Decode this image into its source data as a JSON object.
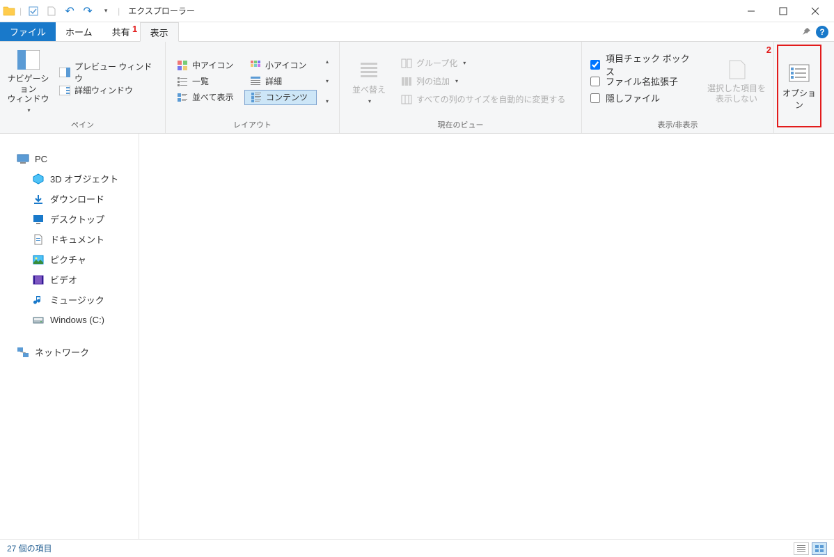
{
  "window": {
    "title": "エクスプローラー"
  },
  "tabs": {
    "file": "ファイル",
    "home": "ホーム",
    "share": "共有",
    "view": "表示"
  },
  "annotations": {
    "one": "1",
    "two": "2"
  },
  "ribbon": {
    "panes": {
      "label": "ペイン",
      "navPane": "ナビゲーション\nウィンドウ",
      "preview": "プレビュー ウィンドウ",
      "details": "詳細ウィンドウ"
    },
    "layout": {
      "label": "レイアウト",
      "items": [
        {
          "label": "中アイコン"
        },
        {
          "label": "小アイコン"
        },
        {
          "label": "一覧"
        },
        {
          "label": "詳細"
        },
        {
          "label": "並べて表示"
        },
        {
          "label": "コンテンツ"
        }
      ]
    },
    "currentView": {
      "label": "現在のビュー",
      "sort": "並べ替え",
      "groupBy": "グループ化",
      "addColumns": "列の追加",
      "sizeAll": "すべての列のサイズを自動的に変更する"
    },
    "showHide": {
      "label": "表示/非表示",
      "checkboxes": "項目チェック ボックス",
      "extensions": "ファイル名拡張子",
      "hidden": "隠しファイル",
      "hideSelected": "選択した項目を\n表示しない"
    },
    "options": "オプション"
  },
  "nav": {
    "pc": "PC",
    "objects3d": "3D オブジェクト",
    "downloads": "ダウンロード",
    "desktop": "デスクトップ",
    "documents": "ドキュメント",
    "pictures": "ピクチャ",
    "videos": "ビデオ",
    "music": "ミュージック",
    "cdrive": "Windows (C:)",
    "network": "ネットワーク"
  },
  "status": {
    "items": "27 個の項目"
  }
}
